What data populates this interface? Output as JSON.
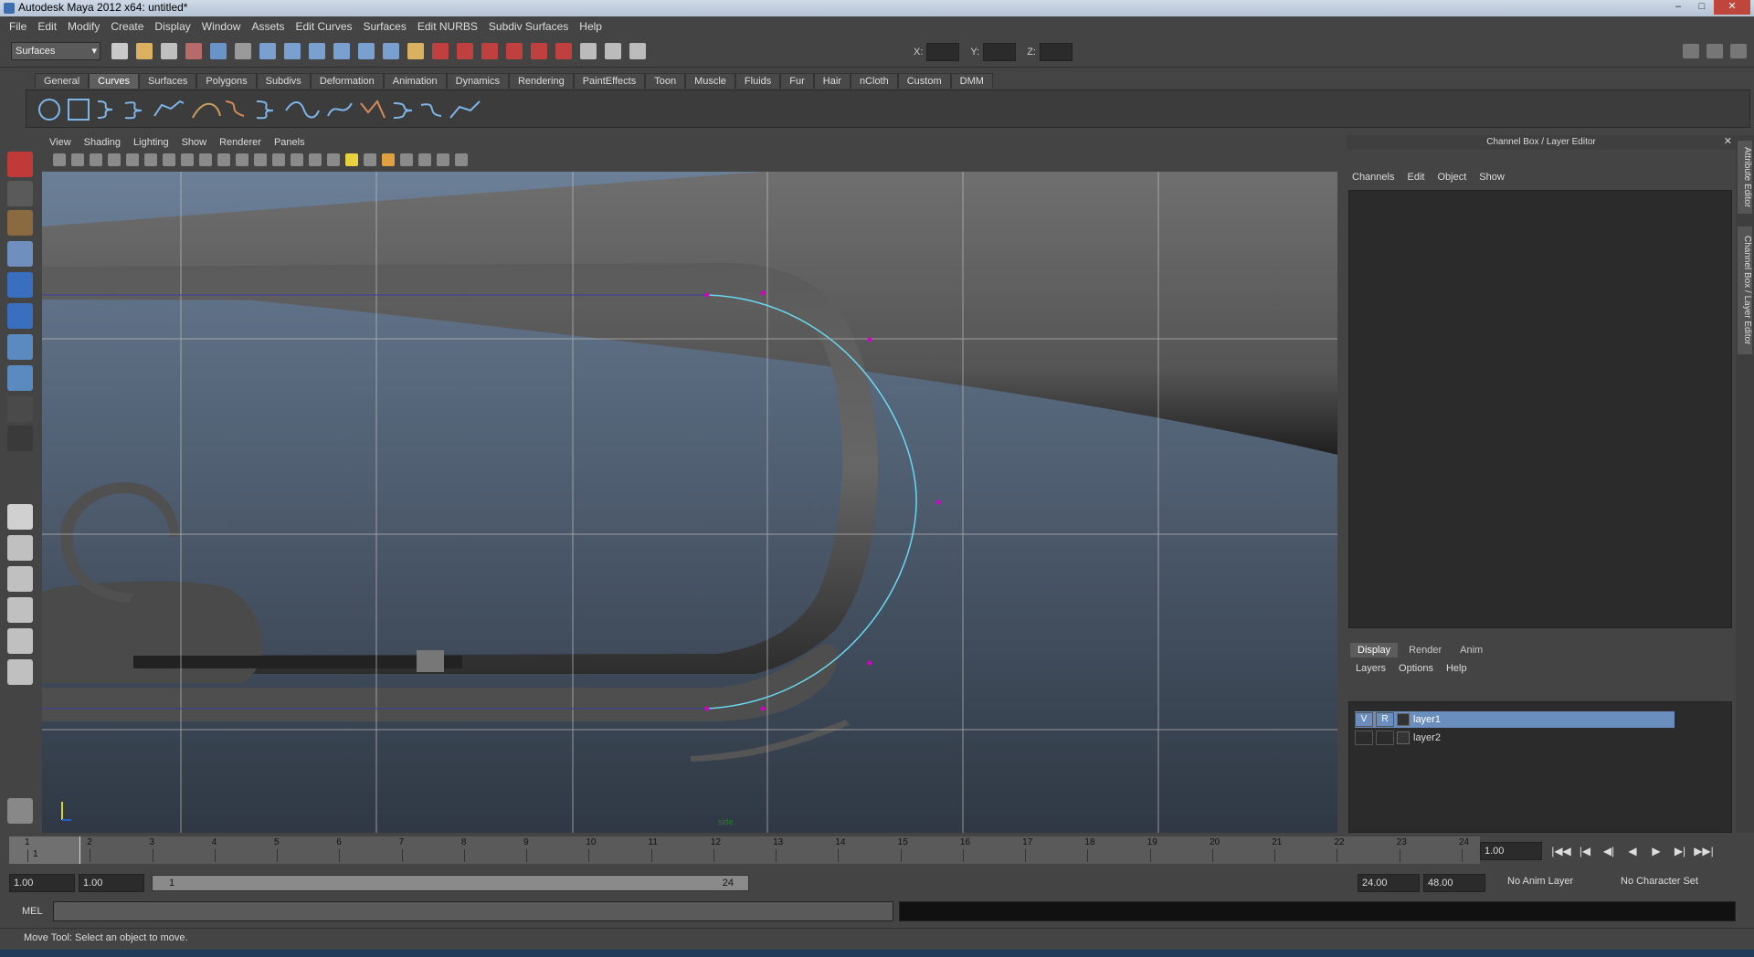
{
  "window": {
    "title": "Autodesk Maya 2012 x64: untitled*",
    "min": "–",
    "max": "□",
    "close": "✕"
  },
  "menus": [
    "File",
    "Edit",
    "Modify",
    "Create",
    "Display",
    "Window",
    "Assets",
    "Edit Curves",
    "Surfaces",
    "Edit NURBS",
    "Subdiv Surfaces",
    "Help"
  ],
  "status": {
    "mode": "Surfaces",
    "x_label": "X:",
    "y_label": "Y:",
    "z_label": "Z:"
  },
  "shelf": {
    "tabs": [
      "General",
      "Curves",
      "Surfaces",
      "Polygons",
      "Subdivs",
      "Deformation",
      "Animation",
      "Dynamics",
      "Rendering",
      "PaintEffects",
      "Toon",
      "Muscle",
      "Fluids",
      "Fur",
      "Hair",
      "nCloth",
      "Custom",
      "DMM"
    ],
    "active_tab": "Curves"
  },
  "panel": {
    "menus": [
      "View",
      "Shading",
      "Lighting",
      "Show",
      "Renderer",
      "Panels"
    ],
    "camera_label": "side"
  },
  "channel_box": {
    "title": "Channel Box / Layer Editor",
    "menus": [
      "Channels",
      "Edit",
      "Object",
      "Show"
    ],
    "layer_tabs": [
      "Display",
      "Render",
      "Anim"
    ],
    "active_layer_tab": "Display",
    "layer_menus": [
      "Layers",
      "Options",
      "Help"
    ],
    "layers": [
      {
        "v": "V",
        "r": "R",
        "name": "layer1",
        "selected": true
      },
      {
        "v": "",
        "r": "",
        "name": "layer2",
        "selected": false
      }
    ]
  },
  "side_tabs": [
    "Attribute Editor",
    "Channel Box / Layer Editor"
  ],
  "timeline": {
    "ticks": [
      "1",
      "2",
      "3",
      "4",
      "5",
      "6",
      "7",
      "8",
      "9",
      "10",
      "11",
      "12",
      "13",
      "14",
      "15",
      "16",
      "17",
      "18",
      "19",
      "20",
      "21",
      "22",
      "23",
      "24"
    ],
    "current": "1",
    "current_time": "1.00"
  },
  "playback": [
    "|◀◀",
    "|◀",
    "◀|",
    "◀",
    "▶",
    "▶|",
    "▶▶|"
  ],
  "range": {
    "start": "1.00",
    "anim_start": "1.00",
    "slider_start": "1",
    "slider_end": "24",
    "anim_end": "24.00",
    "end": "48.00",
    "anim_layer": "No Anim Layer",
    "char_set": "No Character Set"
  },
  "command": {
    "label": "MEL"
  },
  "help_line": "Move Tool: Select an object to move.",
  "colors": {
    "curve": "#69d8f0",
    "cv": "#d600c8",
    "selected_layer": "#6a8fbf"
  }
}
